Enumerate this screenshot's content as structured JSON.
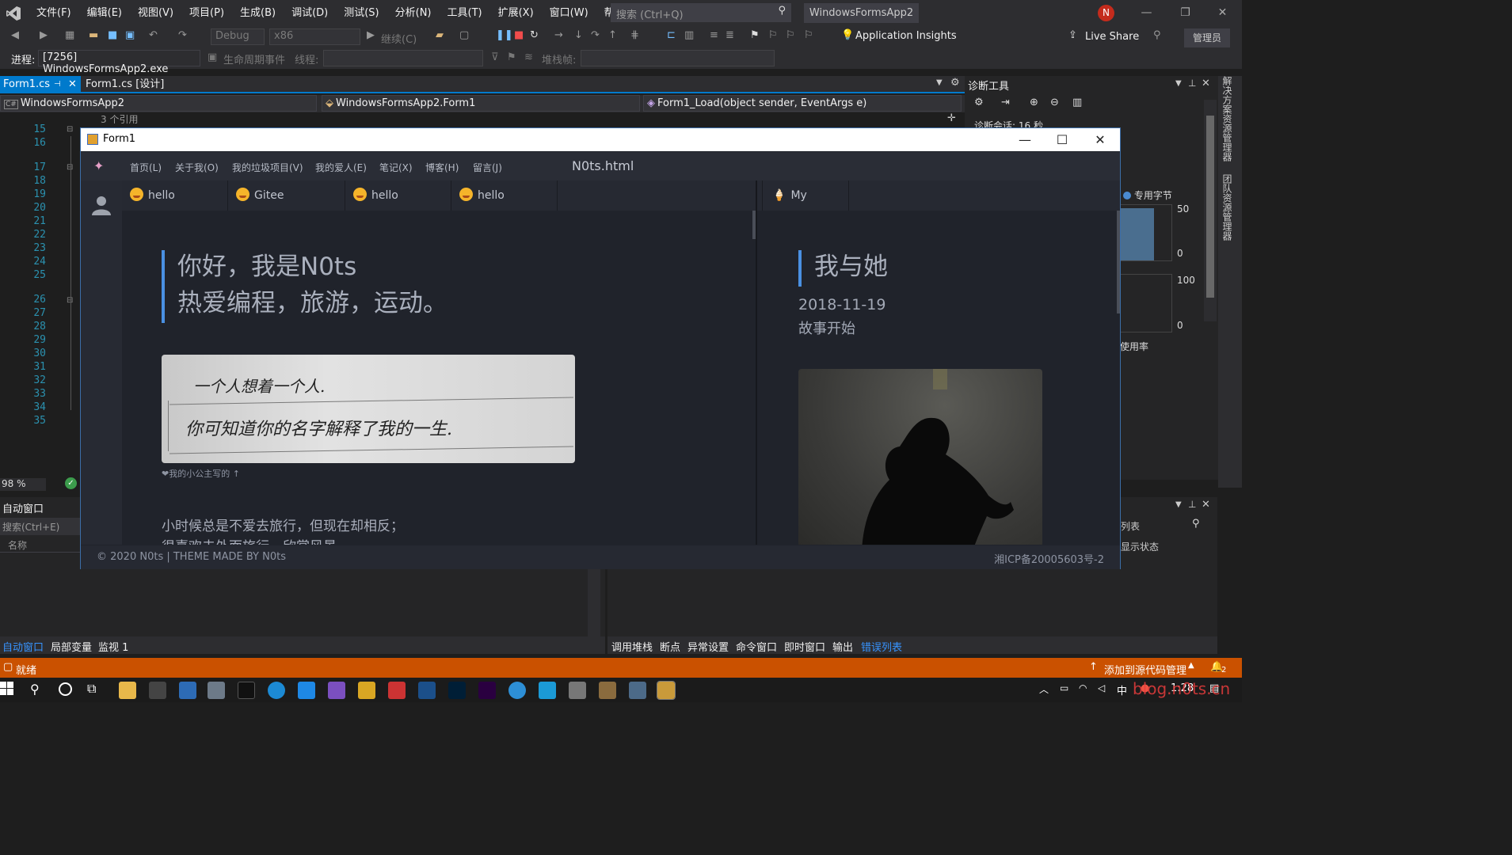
{
  "vs": {
    "menu": [
      "文件(F)",
      "编辑(E)",
      "视图(V)",
      "项目(P)",
      "生成(B)",
      "调试(D)",
      "测试(S)",
      "分析(N)",
      "工具(T)",
      "扩展(X)",
      "窗口(W)",
      "帮助(H)"
    ],
    "search_placeholder": "搜索 (Ctrl+Q)",
    "app_title": "WindowsFormsApp2",
    "avatar_initial": "N",
    "toolbar": {
      "config": "Debug",
      "platform": "x86",
      "continue": "继续(C)",
      "app_insights": "Application Insights",
      "live_share": "Live Share",
      "admin": "管理员"
    },
    "toolbar2": {
      "process_label": "进程:",
      "process_value": "[7256] WindowsFormsApp2.exe",
      "lifecycle": "生命周期事件",
      "thread_label": "线程:",
      "stackframe_label": "堆栈帧:"
    },
    "doc_tabs": [
      "Form1.cs",
      "Form1.cs [设计]"
    ],
    "nav": {
      "project": "WindowsFormsApp2",
      "class": "WindowsFormsApp2.Form1",
      "member": "Form1_Load(object sender, EventArgs e)"
    },
    "references": "3 个引用",
    "line_numbers": [
      "15",
      "16",
      "17",
      "18",
      "19",
      "20",
      "21",
      "22",
      "23",
      "24",
      "25",
      "26",
      "27",
      "28",
      "29",
      "30",
      "31",
      "32",
      "33",
      "34",
      "35"
    ],
    "zoom": "98 %",
    "diag": {
      "title": "诊断工具",
      "session": "诊断会话: 16 秒",
      "private_bytes": "专用字节",
      "mem_max": "50",
      "mem_min": "0",
      "cpu_max": "100",
      "cpu_min": "0",
      "cpu_label": "使用率"
    },
    "vertical_tabs": [
      "解决方案资源管理器",
      "团队资源管理器"
    ],
    "autos": {
      "title": "自动窗口",
      "search": "搜索(Ctrl+E)",
      "col_name": "名称"
    },
    "right_panel": {
      "list_label": "列表",
      "show_status": "显示状态"
    },
    "bottom_tabs_left": [
      "自动窗口",
      "局部变量",
      "监视 1"
    ],
    "bottom_tabs_right": [
      "调用堆栈",
      "断点",
      "异常设置",
      "命令窗口",
      "即时窗口",
      "输出",
      "错误列表"
    ],
    "status": {
      "ready": "就绪",
      "source_control": "添加到源代码管理",
      "notifications": "2"
    },
    "taskbar": {
      "ime": "中",
      "time": "1:28",
      "watermark": "blog.n0ts.cn"
    }
  },
  "form": {
    "title": "Form1",
    "nav": [
      "首页(L)",
      "关于我(O)",
      "我的垃圾项目(V)",
      "我的爱人(E)",
      "笔记(X)",
      "博客(H)",
      "留言(J)"
    ],
    "page_title": "N0ts.html",
    "tabs_left": [
      "hello world.md",
      "Gitee Project.md",
      "hello world.md",
      "hello world.md"
    ],
    "tab_right": "My Life.md",
    "intro_line1": "你好，我是N0ts",
    "intro_line2": "热爱编程，旅游，运动。",
    "handwriting_line1": "一个人想着一个人.",
    "handwriting_line2": "你可知道你的名字解释了我的一生.",
    "caption": "❤我的小公主写的 ↑",
    "para_line1": "小时候总是不爱去旅行，但现在却相反；",
    "para_line2": "很喜欢去外面旅行，欣赏风景。",
    "right_title": "我与她",
    "right_date": "2018-11-19",
    "right_sub": "故事开始",
    "footer_left": "© 2020 N0ts | THEME MADE BY N0ts",
    "footer_right": "湘ICP备20005603号-2"
  }
}
